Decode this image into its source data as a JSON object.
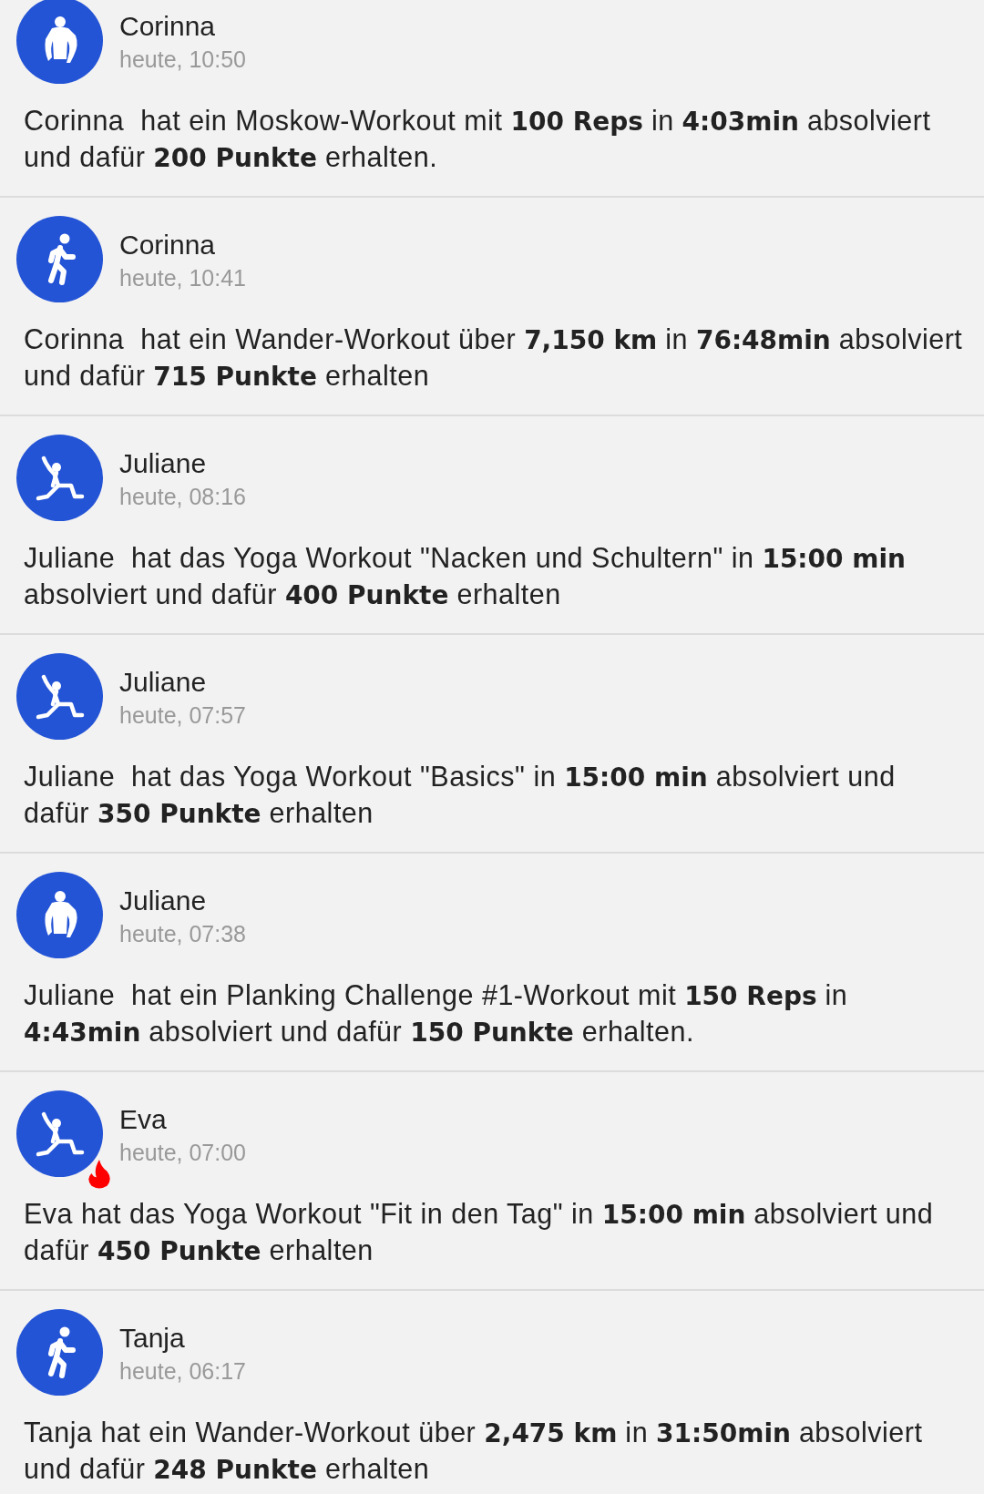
{
  "feed": [
    {
      "kind": "strength",
      "flame": false,
      "name": "Corinna",
      "time": "heute, 10:50",
      "message": "Corinna  hat ein Moskow-Workout mit **100 Reps** in **4:03min** absolviert und dafür **200 Punkte** erhalten."
    },
    {
      "kind": "walking",
      "flame": false,
      "name": "Corinna",
      "time": "heute, 10:41",
      "message": "Corinna  hat ein Wander-Workout über **7,150 km** in **76:48min** absolviert und dafür **715 Punkte** erhalten"
    },
    {
      "kind": "yoga",
      "flame": false,
      "name": "Juliane",
      "time": "heute, 08:16",
      "message": "Juliane  hat das Yoga Workout \"Nacken und Schultern\" in **15:00 min** absolviert und dafür **400 Punkte** erhalten"
    },
    {
      "kind": "yoga",
      "flame": false,
      "name": "Juliane",
      "time": "heute, 07:57",
      "message": "Juliane  hat das Yoga Workout \"Basics\" in **15:00 min** absolviert und dafür **350 Punkte** erhalten"
    },
    {
      "kind": "strength",
      "flame": false,
      "name": "Juliane",
      "time": "heute, 07:38",
      "message": "Juliane  hat ein Planking Challenge #1-Workout mit **150 Reps** in **4:43min** absolviert und dafür **150 Punkte** erhalten."
    },
    {
      "kind": "yoga",
      "flame": true,
      "name": "Eva",
      "time": "heute, 07:00",
      "message": "Eva hat das Yoga Workout \"Fit in den Tag\" in **15:00 min** absolviert und dafür **450 Punkte** erhalten"
    },
    {
      "kind": "walking",
      "flame": false,
      "name": "Tanja",
      "time": "heute, 06:17",
      "message": "Tanja hat ein Wander-Workout über **2,475 km** in **31:50min** absolviert und dafür **248 Punkte** erhalten"
    }
  ]
}
